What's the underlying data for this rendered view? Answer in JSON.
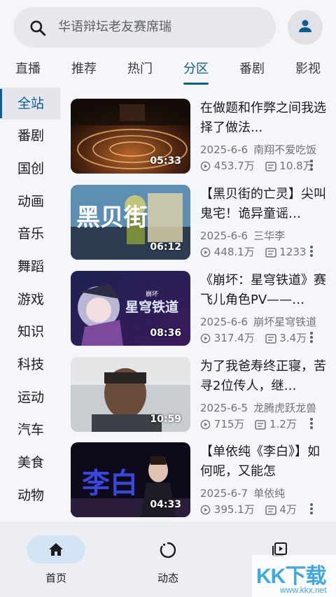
{
  "search": {
    "placeholder": "华语辩坛老友赛席瑞"
  },
  "tabs": [
    {
      "label": "直播"
    },
    {
      "label": "推荐"
    },
    {
      "label": "热门"
    },
    {
      "label": "分区"
    },
    {
      "label": "番剧"
    },
    {
      "label": "影视"
    }
  ],
  "active_tab": "分区",
  "sidebar": {
    "items": [
      {
        "label": "全站"
      },
      {
        "label": "番剧"
      },
      {
        "label": "国创"
      },
      {
        "label": "动画"
      },
      {
        "label": "音乐"
      },
      {
        "label": "舞蹈"
      },
      {
        "label": "游戏"
      },
      {
        "label": "知识"
      },
      {
        "label": "科技"
      },
      {
        "label": "运动"
      },
      {
        "label": "汽车"
      },
      {
        "label": "美食"
      },
      {
        "label": "动物"
      }
    ],
    "active": "全站"
  },
  "videos": [
    {
      "title": "在做题和作弊之间我选择了做法...",
      "date": "2025-6-6",
      "uploader": "南翔不爱吃饭",
      "views": "453.7万",
      "danmaku": "10.8万",
      "duration": "05:33"
    },
    {
      "title": "【黑贝街的亡灵】尖叫鬼宅！诡异童谣…",
      "date": "2025-6-6",
      "uploader": "三华李",
      "views": "448.1万",
      "danmaku": "1233",
      "duration": "06:12"
    },
    {
      "title": "《崩坏：星穹铁道》赛飞儿角色PV——…",
      "date": "2025-6-6",
      "uploader": "崩坏星穹铁道",
      "views": "317.4万",
      "danmaku": "3.4万",
      "duration": "08:36"
    },
    {
      "title": "为了我爸寿终正寝，苦寻2位传人，继…",
      "date": "2025-6-5",
      "uploader": "龙腾虎跃龙兽",
      "views": "715万",
      "danmaku": "1.2万",
      "duration": "10:59"
    },
    {
      "title": "【单依纯《李白》】如何呢，又能怎",
      "date": "2025-6-7",
      "uploader": "单依纯",
      "views": "395.1万",
      "danmaku": "4万",
      "duration": "04:33"
    }
  ],
  "thumb_text": {
    "v2": "黑贝街",
    "v3_small": "崩坏",
    "v3": "星穹铁道",
    "v5": "李白"
  },
  "bottom_nav": [
    {
      "label": "首页",
      "icon": "home-icon"
    },
    {
      "label": "动态",
      "icon": "activity-icon"
    },
    {
      "label": "",
      "icon": "video-library-icon"
    }
  ],
  "watermark": {
    "text": "KK下载",
    "url": "www.kkx.net"
  },
  "colors": {
    "accent": "#0c5e90",
    "background": "#f5f6fa",
    "nav_pill": "#d3e4f5"
  }
}
